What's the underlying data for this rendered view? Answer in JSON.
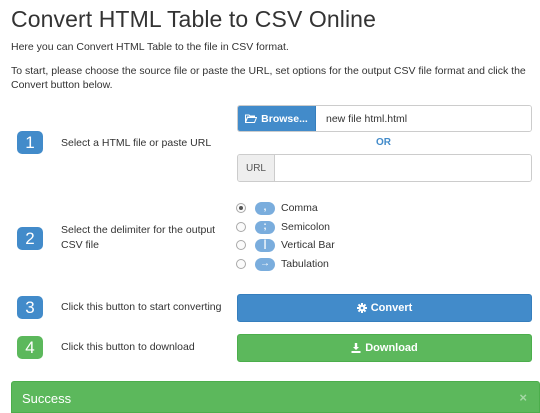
{
  "header": {
    "title": "Convert HTML Table to CSV Online",
    "subtitle": "Here you can Convert HTML Table to the file in CSV format.",
    "intro": "To start, please choose the source file or paste the URL, set options for the output CSV file format and click the Convert button below."
  },
  "steps": [
    {
      "number": "1",
      "text": "Select a HTML file or paste URL"
    },
    {
      "number": "2",
      "text": "Select the delimiter for the output CSV file"
    },
    {
      "number": "3",
      "text": "Click this button to start converting"
    },
    {
      "number": "4",
      "text": "Click this button to download"
    }
  ],
  "file": {
    "browse_label": "Browse...",
    "browse_icon": "folder-open-icon",
    "file_name": "new file html.html",
    "or_label": "OR",
    "url_label": "URL",
    "url_value": "",
    "url_placeholder": ""
  },
  "delimiters": {
    "selected": "Comma",
    "options": [
      {
        "symbol": ",",
        "label": "Comma"
      },
      {
        "symbol": ";",
        "label": "Semicolon"
      },
      {
        "symbol": "|",
        "label": "Vertical Bar"
      },
      {
        "symbol": "→",
        "label": "Tabulation"
      }
    ]
  },
  "actions": {
    "convert_label": "Convert",
    "convert_icon": "gear-icon",
    "download_label": "Download",
    "download_icon": "download-icon"
  },
  "alert": {
    "title": "Success",
    "close_label": "×"
  },
  "colors": {
    "primary": "#428bca",
    "success": "#5cb85c",
    "link": "#428bca"
  }
}
